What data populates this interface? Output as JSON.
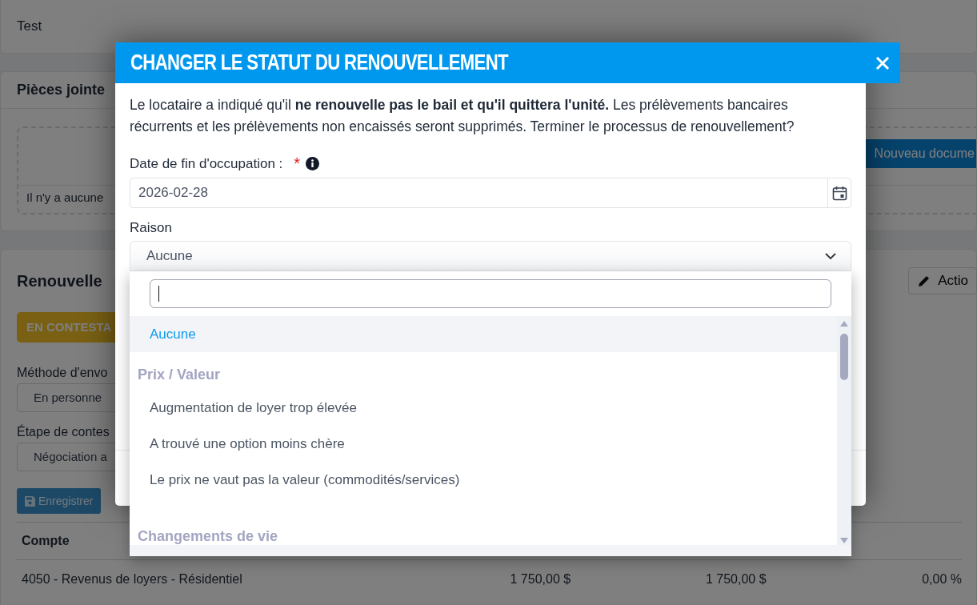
{
  "background": {
    "top_card": {
      "text": "Test"
    },
    "attachments": {
      "title": "Pièces jointe",
      "empty_text": "Il n'y a aucune",
      "new_button": "Nouveau docume"
    },
    "renewal": {
      "title": "Renouvelle",
      "actions_button": "Actio",
      "status_badge": "EN CONTESTA",
      "fields": [
        {
          "label": "Méthode d'envo",
          "value": "En personne"
        },
        {
          "label": "Étape de contes",
          "value": "Négociation a"
        }
      ],
      "save_button": "Enregistrer",
      "table": {
        "columns": [
          "Compte"
        ],
        "rows": [
          [
            "4050 - Revenus de loyers - Résidentiel",
            "1 750,00 $",
            "1 750,00 $",
            "0,00 %"
          ]
        ]
      }
    }
  },
  "modal": {
    "title": "CHANGER LE STATUT DU RENOUVELLEMENT",
    "message": "Le locataire a indiqué qu'il **ne renouvelle pas le bail et qu'il quittera l'unité.** Les prélèvements bancaires récurrents et les prélèvements non encaissés seront supprimés. Terminer le processus de renouvellement?",
    "end_date": {
      "label": "Date de fin d'occupation :",
      "required_mark": "*",
      "value": "2026-02-28"
    },
    "reason": {
      "label": "Raison",
      "value": "Aucune",
      "expanded": true,
      "options": [
        {
          "kind": "option",
          "label": "Aucune",
          "selected": true
        },
        {
          "kind": "group",
          "label": "Prix / Valeur"
        },
        {
          "kind": "option",
          "label": "Augmentation de loyer trop élevée",
          "selected": false
        },
        {
          "kind": "option",
          "label": "A trouvé une option moins chère",
          "selected": false
        },
        {
          "kind": "option",
          "label": "Le prix ne vaut pas la valeur (commodités/services)",
          "selected": false
        },
        {
          "kind": "group",
          "label": "Changements de vie"
        }
      ]
    }
  }
}
